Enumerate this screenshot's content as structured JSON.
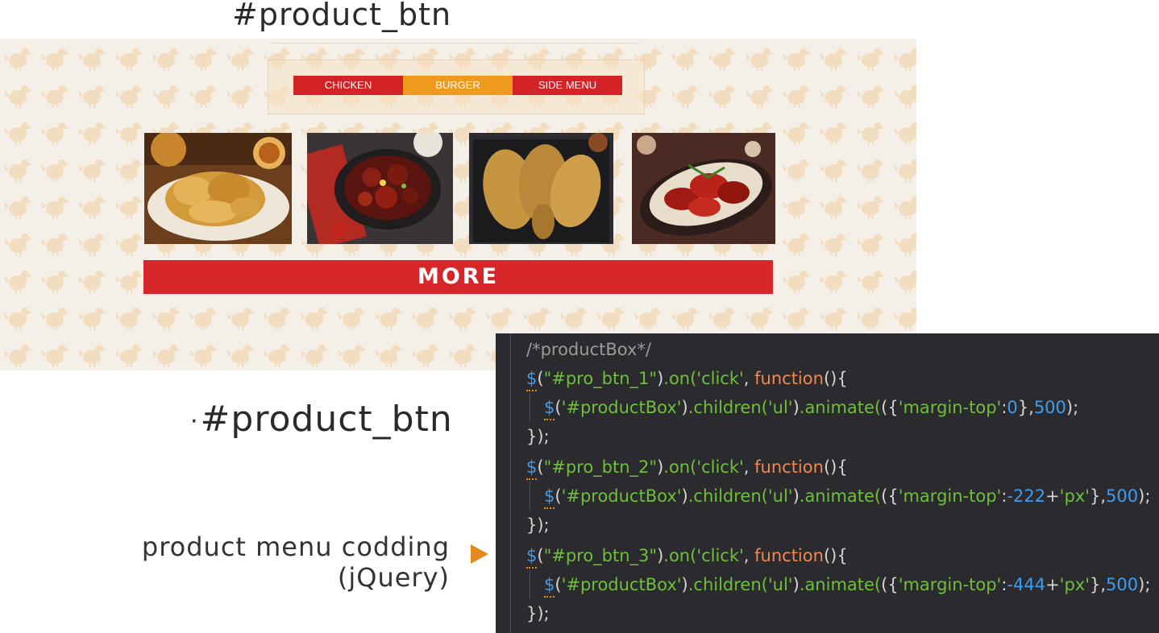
{
  "headings": {
    "top": "#product_btn",
    "middle_bullet": "·",
    "middle": "#product_btn"
  },
  "showcase": {
    "tabs": [
      {
        "label": "CHICKEN",
        "color": "#d42327"
      },
      {
        "label": "BURGER",
        "color": "#ef9a1e"
      },
      {
        "label": "SIDE MENU",
        "color": "#d42327"
      }
    ],
    "products": [
      {
        "icon": "fried-chicken-plate-photo"
      },
      {
        "icon": "spicy-chicken-pan-photo"
      },
      {
        "icon": "crispy-drumsticks-photo"
      },
      {
        "icon": "glazed-chicken-platter-photo"
      }
    ],
    "more_label": "MORE"
  },
  "caption": {
    "line1": "product menu codding",
    "line2": "(jQuery)"
  },
  "code": {
    "comment": "/*productBox*/",
    "blocks": [
      {
        "selector": "\"#pro_btn_1\"",
        "value": "0",
        "suffix": ""
      },
      {
        "selector": "\"#pro_btn_2\"",
        "value": "-222",
        "suffix": "'px'"
      },
      {
        "selector": "\"#pro_btn_3\"",
        "value": "-444",
        "suffix": "'px'"
      }
    ],
    "tokens": {
      "dollar": "$",
      "on": ".on(",
      "click": "'click'",
      "function": "function",
      "fn_open": "(){",
      "target": "'#productBox'",
      "children": ".children(",
      "ul": "'ul'",
      "animate": ".animate(",
      "prop": "'margin-top'",
      "duration": "500",
      "close": "});"
    }
  },
  "colors": {
    "accent_red": "#d7262a",
    "accent_orange": "#e38a1f",
    "code_bg": "#2b2b2f",
    "showcase_bg": "#f4efe7"
  }
}
